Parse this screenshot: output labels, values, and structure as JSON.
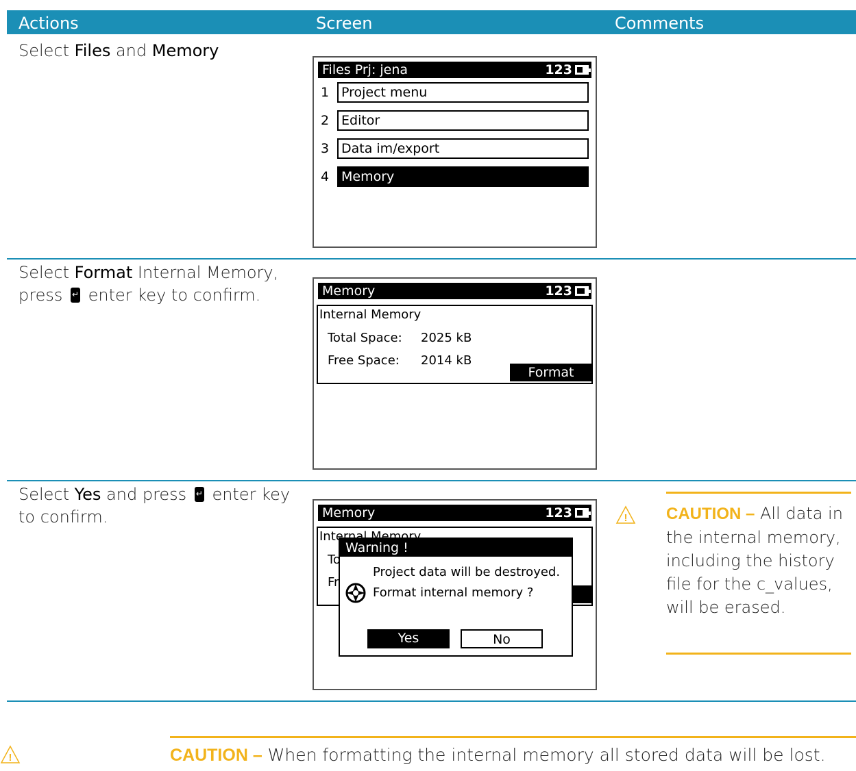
{
  "header": {
    "actions": "Actions",
    "screen": "Screen",
    "comments": "Comments"
  },
  "step1": {
    "a1": "Select ",
    "files": "Files",
    "a2": " and ",
    "memory": "Memory",
    "screen": {
      "title": "Files  Prj: jena",
      "status": "123",
      "items": [
        {
          "num": "1",
          "label": "Project menu"
        },
        {
          "num": "2",
          "label": "Editor"
        },
        {
          "num": "3",
          "label": "Data im/export"
        },
        {
          "num": "4",
          "label": "Memory"
        }
      ]
    }
  },
  "step2": {
    "a1": "Select ",
    "format": "Format",
    "a2": " Internal Memory,",
    "a3": "press ",
    "a4": " enter key to confirm.",
    "screen": {
      "title": "Memory",
      "status": "123",
      "panel_title": "Internal Memory",
      "total_label": "Total Space:",
      "total_value": "2025 kB",
      "free_label": "Free Space:",
      "free_value": "2014 kB",
      "format_button": "Format"
    }
  },
  "step3": {
    "a1": "Select ",
    "yes": "Yes",
    "a2": " and press ",
    "a3": " enter key",
    "a4": "to confirm.",
    "screen": {
      "title": "Memory",
      "status": "123",
      "panel_title_partial": "Internal Memory",
      "t_partial": "To",
      "f_partial": "Fr",
      "dialog_title": "Warning !",
      "dialog_line1": "Project data will be destroyed.",
      "dialog_line2": "Format internal memory ?",
      "yes_button": "Yes",
      "no_button": "No"
    },
    "caution_label": "CAUTION –",
    "caution_text": " All data in the internal memory, including the history file for the c_values, will be erased."
  },
  "bottom_caution": {
    "label": "CAUTION –",
    "text": "  When formatting the internal memory all stored data will be lost."
  },
  "colors": {
    "header": "#1b8fb6",
    "caution": "#f2b31b"
  },
  "icons": [
    "enter-key-icon",
    "battery-icon",
    "warning-triangle-icon",
    "trimble-logo-icon"
  ]
}
